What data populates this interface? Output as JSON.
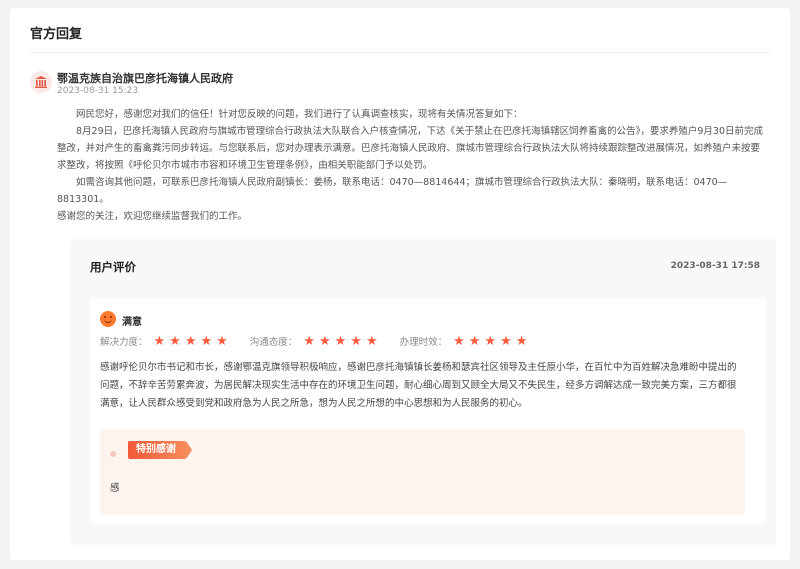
{
  "panel": {
    "title": "官方回复"
  },
  "org": {
    "icon": "government-building-icon",
    "name": "鄂温克族自治旗巴彦托海镇人民政府",
    "date": "2023-08-31 15:23"
  },
  "reply": {
    "p1": "网民您好，感谢您对我们的信任！针对您反映的问题，我们进行了认真调查核实，现将有关情况答复如下：",
    "p2": "8月29日，巴彦托海镇人民政府与旗城市管理综合行政执法大队联合入户核查情况，下达《关于禁止在巴彦托海镇辖区饲养畜禽的公告》，要求养殖户9月30日前完成整改，并对产生的畜禽粪污同步转运。与您联系后，您对办理表示满意。巴彦托海镇人民政府、旗城市管理综合行政执法大队将持续跟踪整改进展情况，如养殖户未按要求整改，将按照《呼伦贝尔市城市市容和环境卫生管理条例》，由相关职能部门予以处罚。",
    "p3": "如需咨询其他问题，可联系巴彦托海镇人民政府副镇长：姜杨，联系电话：0470—8814644；旗城市管理综合行政执法大队：秦晓明，联系电话：0470—8813301。",
    "p4": "感谢您的关注，欢迎您继续监督我们的工作。"
  },
  "evaluation": {
    "title": "用户评价",
    "date": "2023-08-31 17:58",
    "face_icon": "smiley-face-icon",
    "satisfaction": "满意",
    "ratings": [
      {
        "label": "解决力度：",
        "stars": 5
      },
      {
        "label": "沟通态度：",
        "stars": 5
      },
      {
        "label": "办理时效：",
        "stars": 5
      }
    ],
    "comment_line1": "感谢呼伦贝尔市书记和市长，感谢鄂温克旗领导积极响应，感谢巴彦托海镇镇长姜杨和瑟宾社区领导及主任原小华，在百忙中为百姓解决急难盼中提出的",
    "comment_line2": "问题，不辞辛苦劳累奔波，为居民解决现实生活中存在的环境卫生问题，耐心细心周到又顾全大局又不失民生，经多方调解达成一致完美方案，三方都很",
    "comment_line3": "满意，让人民群众感受到党和政府急为人民之所急，想为人民之所想的中心思想和为人民服务的初心。",
    "thanks_badge": "特别感谢",
    "thanks_text": "感",
    "star_color": "#ff5a3c"
  }
}
